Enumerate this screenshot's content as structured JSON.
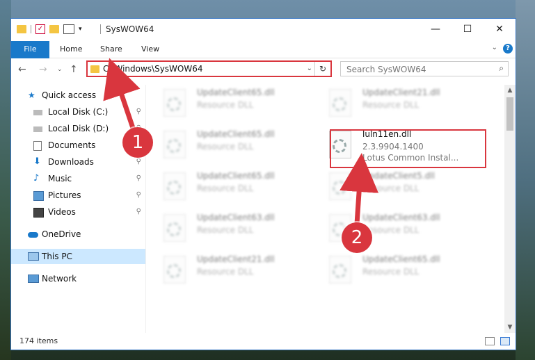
{
  "window": {
    "title": "SysWOW64",
    "min_glyph": "—",
    "max_glyph": "☐",
    "close_glyph": "✕"
  },
  "ribbon": {
    "tabs": [
      "File",
      "Home",
      "Share",
      "View"
    ],
    "expand_glyph": "⌄",
    "help_glyph": "?"
  },
  "address": {
    "path": "C:\\Windows\\SysWOW64",
    "dropdown_glyph": "⌄",
    "refresh_glyph": "↻"
  },
  "nav": {
    "back_glyph": "←",
    "forward_glyph": "→",
    "recent_glyph": "⌄",
    "up_glyph": "↑"
  },
  "search": {
    "placeholder": "Search SysWOW64",
    "icon": "search-icon"
  },
  "sidebar": {
    "items": [
      {
        "label": "Quick access",
        "icon": "star-icon"
      },
      {
        "label": "Local Disk (C:)",
        "icon": "drive-icon",
        "pinned": true
      },
      {
        "label": "Local Disk (D:)",
        "icon": "drive-icon",
        "pinned": true
      },
      {
        "label": "Documents",
        "icon": "documents-icon",
        "pinned": true
      },
      {
        "label": "Downloads",
        "icon": "download-icon",
        "pinned": true
      },
      {
        "label": "Music",
        "icon": "music-icon",
        "pinned": true
      },
      {
        "label": "Pictures",
        "icon": "pictures-icon",
        "pinned": true
      },
      {
        "label": "Videos",
        "icon": "videos-icon",
        "pinned": true
      },
      {
        "label": "OneDrive",
        "icon": "cloud-icon"
      },
      {
        "label": "This PC",
        "icon": "computer-icon",
        "selected": true
      },
      {
        "label": "Network",
        "icon": "network-icon"
      }
    ],
    "pin_glyph": "📌"
  },
  "files": [
    {
      "name": "UpdateClient65.dll",
      "type": "Resource DLL"
    },
    {
      "name": "UpdateClient21.dll",
      "type": "Resource DLL"
    },
    {
      "name": "UpdateClient65.dll",
      "type": "Resource DLL"
    },
    {
      "name": "UpdateClient65.dll",
      "type": "Resource DLL"
    },
    {
      "name": "UpdateClient5.dll",
      "type": "Resource DLL"
    },
    {
      "name": "UpdateClient63.dll",
      "type": "Resource DLL"
    },
    {
      "name": "UpdateClient63.dll",
      "type": "Resource DLL"
    },
    {
      "name": "UpdateClient21.dll",
      "type": "Resource DLL"
    },
    {
      "name": "UpdateClient65.dll",
      "type": "Resource DLL"
    }
  ],
  "highlighted_file": {
    "name": "luln11en.dll",
    "version": "2.3.9904.1400",
    "description": "Lotus Common Instal..."
  },
  "status": {
    "item_count": "174 items"
  },
  "annotations": {
    "step1": "1",
    "step2": "2",
    "color": "#d9363e"
  }
}
